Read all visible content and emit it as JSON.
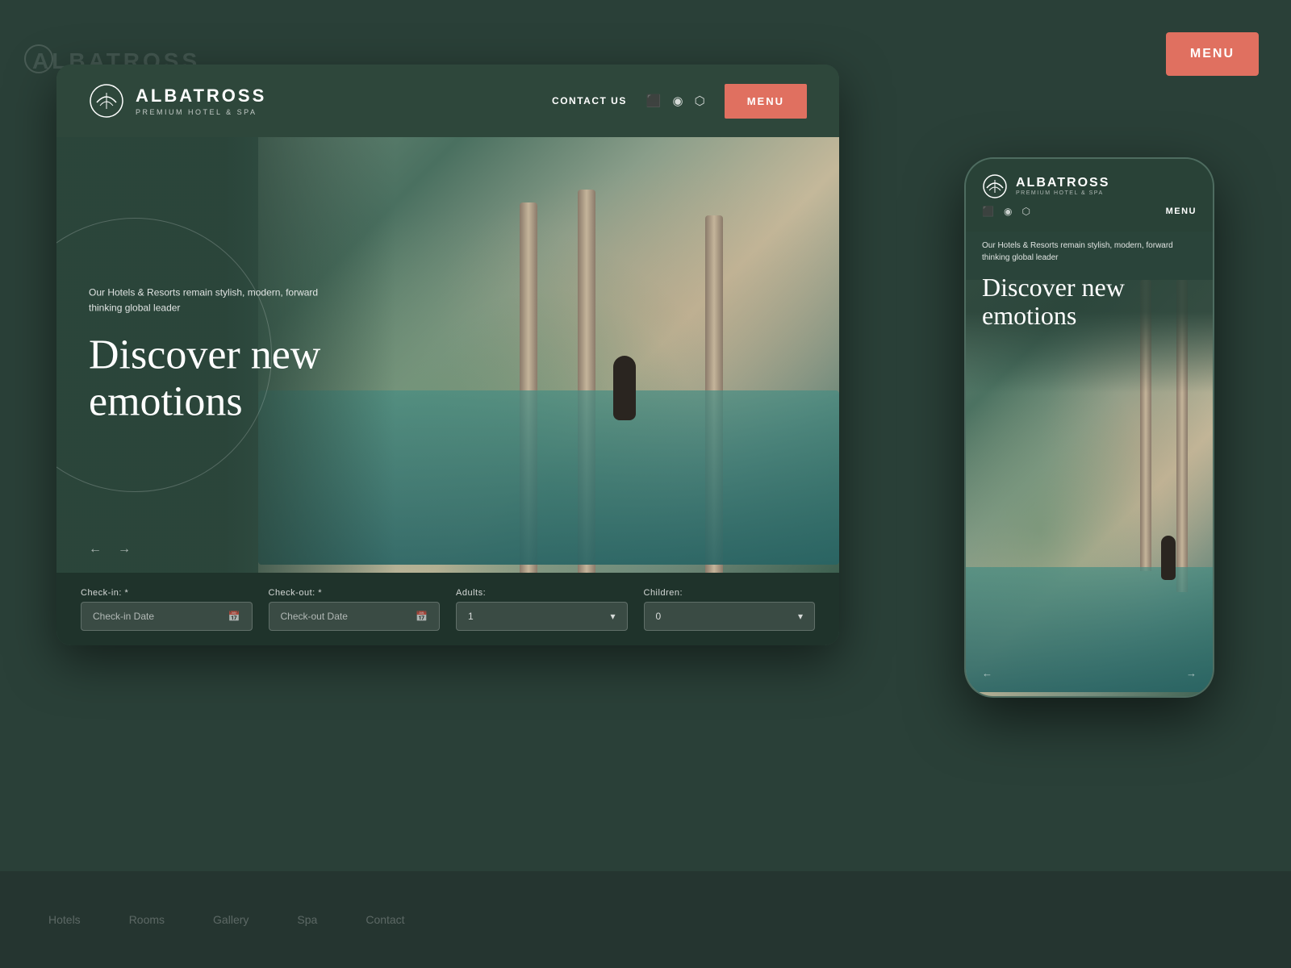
{
  "background": {
    "brand_text": "ALBATROSS",
    "menu_label": "MENU"
  },
  "desktop": {
    "nav": {
      "logo_title": "ALBATROSS",
      "logo_subtitle": "PREMIUM HOTEL & SPA",
      "contact_label": "CONTACT US",
      "menu_label": "MENU",
      "social_icons": [
        "foursquare",
        "tripadvisor",
        "instagram"
      ]
    },
    "hero": {
      "subtitle": "Our Hotels & Resorts remain stylish, modern, forward thinking global leader",
      "title_line1": "Discover new",
      "title_line2": "emotions",
      "arrow_left": "←",
      "arrow_right": "→"
    },
    "booking": {
      "checkin_label": "Check-in: *",
      "checkin_placeholder": "Check-in Date",
      "checkout_label": "Check-out: *",
      "checkout_placeholder": "Check-out Date",
      "adults_label": "Adults:",
      "adults_value": "1",
      "children_label": "Children:",
      "children_value": "0"
    }
  },
  "mobile": {
    "nav": {
      "logo_title": "ALBATROSS",
      "logo_subtitle": "PREMIUM HOTEL & SPA",
      "menu_label": "MENU"
    },
    "hero": {
      "subtitle": "Our Hotels & Resorts remain stylish, modern, forward thinking global leader",
      "title_line1": "Discover new",
      "title_line2": "emotions",
      "arrow_left": "←",
      "arrow_right": "→"
    }
  },
  "colors": {
    "salmon": "#e07060",
    "dark_green": "#2a4038",
    "medium_green": "#3a5c4e",
    "nav_bg": "rgba(40,65,55,0.97)"
  }
}
